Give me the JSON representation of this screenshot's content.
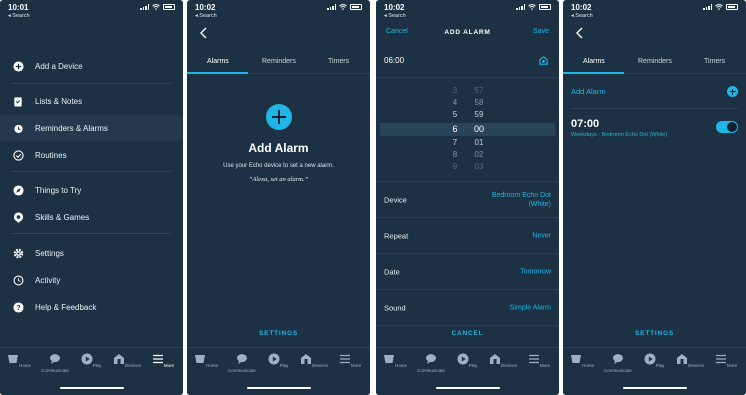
{
  "screens": [
    {
      "status": {
        "time": "10:01",
        "back": "◂ Search"
      },
      "menu": [
        {
          "label": "Add a Device",
          "icon": "plus-circle-icon"
        },
        {
          "label": "Lists & Notes",
          "icon": "clipboard-icon"
        },
        {
          "label": "Reminders & Alarms",
          "icon": "alarm-clock-icon",
          "active": true
        },
        {
          "label": "Routines",
          "icon": "routine-check-icon"
        },
        {
          "label": "Things to Try",
          "icon": "compass-icon"
        },
        {
          "label": "Skills & Games",
          "icon": "skills-icon"
        },
        {
          "label": "Settings",
          "icon": "gear-icon"
        },
        {
          "label": "Activity",
          "icon": "history-icon"
        },
        {
          "label": "Help & Feedback",
          "icon": "help-icon"
        }
      ],
      "tabs": [
        {
          "label": "Home"
        },
        {
          "label": "Communicate"
        },
        {
          "label": "Play"
        },
        {
          "label": "Devices"
        },
        {
          "label": "More",
          "selected": true
        }
      ]
    },
    {
      "status": {
        "time": "10:02",
        "back": "◂ Search"
      },
      "toptabs": [
        "Alarms",
        "Reminders",
        "Timers"
      ],
      "empty": {
        "title": "Add Alarm",
        "line1": "Use your Echo device to set a new alarm.",
        "line2": "“Alexa, set an alarm.”"
      },
      "settings": "SETTINGS",
      "tabs": [
        {
          "label": "Home"
        },
        {
          "label": "Communicate"
        },
        {
          "label": "Play"
        },
        {
          "label": "Devices"
        },
        {
          "label": "More"
        }
      ]
    },
    {
      "status": {
        "time": "10:02",
        "back": "◂ Search"
      },
      "header": {
        "cancel": "Cancel",
        "title": "ADD ALARM",
        "save": "Save"
      },
      "time_value": "06:00",
      "picker": {
        "hours": [
          "3",
          "4",
          "5",
          "6",
          "7",
          "8",
          "9"
        ],
        "minutes": [
          "57",
          "58",
          "59",
          "00",
          "01",
          "02",
          "03"
        ]
      },
      "fields": [
        {
          "label": "Device",
          "value": "Bedroom Echo Dot",
          "value2": "(White)"
        },
        {
          "label": "Repeat",
          "value": "Never"
        },
        {
          "label": "Date",
          "value": "Tomorrow"
        },
        {
          "label": "Sound",
          "value": "Simple Alarm"
        }
      ],
      "cancel": "CANCEL",
      "tabs": [
        {
          "label": "Home"
        },
        {
          "label": "Communicate"
        },
        {
          "label": "Play"
        },
        {
          "label": "Devices"
        },
        {
          "label": "More"
        }
      ]
    },
    {
      "status": {
        "time": "10:02",
        "back": "◂ Search"
      },
      "toptabs": [
        "Alarms",
        "Reminders",
        "Timers"
      ],
      "add_alarm": "Add Alarm",
      "alarm": {
        "time": "07:00",
        "detail": "Weekdays · Bedroom Echo Dot (White)",
        "enabled": true
      },
      "settings": "SETTINGS",
      "tabs": [
        {
          "label": "Home"
        },
        {
          "label": "Communicate"
        },
        {
          "label": "Play"
        },
        {
          "label": "Devices"
        },
        {
          "label": "More"
        }
      ]
    }
  ],
  "colors": {
    "background": "#1c3144",
    "accent": "#1fb6e6",
    "text": "#ffffff"
  }
}
